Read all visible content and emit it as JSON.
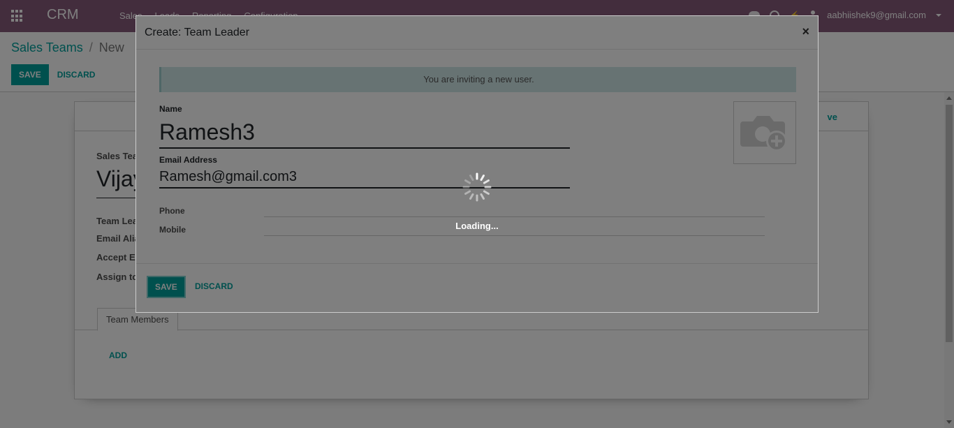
{
  "navbar": {
    "brand": "CRM",
    "menu": [
      "Sales",
      "Leads",
      "Reporting",
      "Configuration"
    ],
    "user": "aabhiishek9@gmail.com"
  },
  "breadcrumb": {
    "parent": "Sales Teams",
    "separator": "/",
    "current": "New"
  },
  "control_panel": {
    "save_label": "SAVE",
    "discard_label": "DISCARD"
  },
  "sheet": {
    "stat_button": "ve",
    "team_label": "Sales Tea",
    "team_name": "Vijay",
    "fields": [
      "Team Lea",
      "Email Alia",
      "Accept Er",
      "Assign to"
    ],
    "tab": "Team Members",
    "add_label": "ADD"
  },
  "modal": {
    "title": "Create: Team Leader",
    "close": "×",
    "alert": "You are inviting a new user.",
    "name_label": "Name",
    "name_value": "Ramesh3",
    "email_label": "Email Address",
    "email_value": "Ramesh@gmail.com3",
    "phone_label": "Phone",
    "mobile_label": "Mobile",
    "save_label": "SAVE",
    "discard_label": "DISCARD"
  },
  "loading": {
    "text": "Loading..."
  },
  "colors": {
    "brand": "#875a7b",
    "accent": "#00a09d",
    "alert_bg": "#cfe6e6"
  }
}
